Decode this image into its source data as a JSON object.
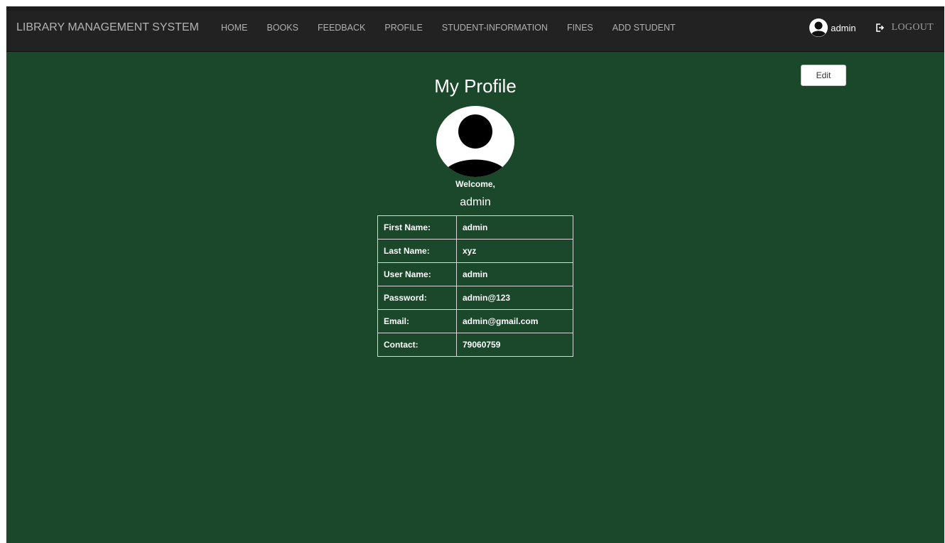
{
  "navbar": {
    "brand": "LIBRARY MANAGEMENT SYSTEM",
    "links": [
      "HOME",
      "BOOKS",
      "FEEDBACK",
      "PROFILE",
      "STUDENT-INFORMATION",
      "FINES",
      "ADD STUDENT"
    ],
    "user_name": "admin",
    "logout_label": "LOGOUT",
    "user_icon": "user-circle-icon",
    "logout_icon": "logout-icon"
  },
  "page": {
    "title": "My Profile",
    "edit_label": "Edit",
    "welcome": "Welcome,",
    "welcome_name": "admin",
    "avatar_icon": "user-avatar-icon"
  },
  "profile": {
    "rows": [
      {
        "label": "First Name:",
        "value": "admin"
      },
      {
        "label": "Last Name:",
        "value": "xyz"
      },
      {
        "label": "User Name:",
        "value": "admin"
      },
      {
        "label": "Password:",
        "value": "admin@123"
      },
      {
        "label": "Email:",
        "value": "admin@gmail.com"
      },
      {
        "label": "Contact:",
        "value": "79060759"
      }
    ]
  },
  "colors": {
    "background": "#1b472a",
    "navbar": "#222222"
  }
}
